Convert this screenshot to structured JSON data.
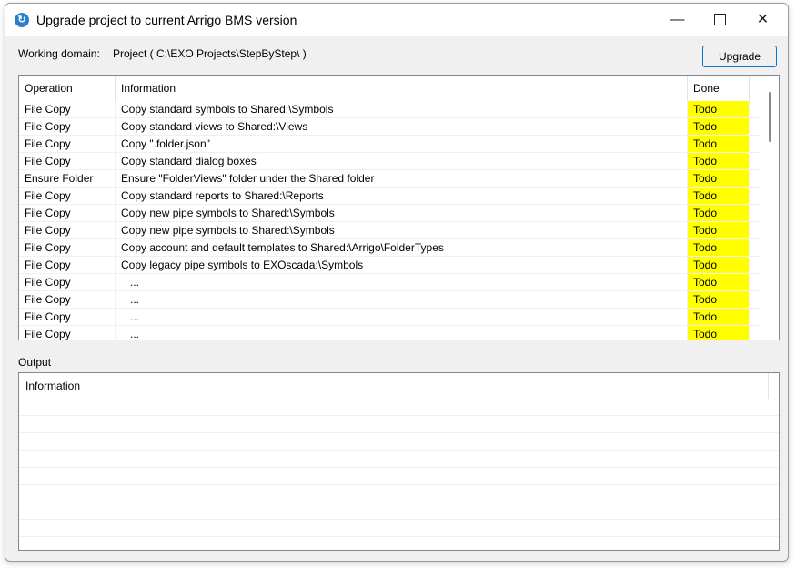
{
  "window": {
    "title": "Upgrade project to current Arrigo BMS version",
    "controls": {
      "minimize": "—",
      "maximize": "",
      "close": "✕"
    }
  },
  "header": {
    "working_domain_label": "Working domain:",
    "working_domain_value": "Project ( C:\\EXO Projects\\StepByStep\\ )",
    "upgrade_button": "Upgrade"
  },
  "operations": {
    "columns": [
      "Operation",
      "Information",
      "Done"
    ],
    "rows": [
      {
        "operation": "File Copy",
        "information": "Copy standard symbols to Shared:\\Symbols",
        "done": "Todo"
      },
      {
        "operation": "File Copy",
        "information": "Copy standard views to Shared:\\Views",
        "done": "Todo"
      },
      {
        "operation": "File Copy",
        "information": "Copy \".folder.json\"",
        "done": "Todo"
      },
      {
        "operation": "File Copy",
        "information": "Copy standard dialog boxes",
        "done": "Todo"
      },
      {
        "operation": "Ensure Folder",
        "information": "Ensure \"FolderViews\" folder under the Shared folder",
        "done": "Todo"
      },
      {
        "operation": "File Copy",
        "information": "Copy standard reports to Shared:\\Reports",
        "done": "Todo"
      },
      {
        "operation": "File Copy",
        "information": "Copy new pipe symbols to Shared:\\Symbols",
        "done": "Todo"
      },
      {
        "operation": "File Copy",
        "information": "Copy new pipe symbols to Shared:\\Symbols",
        "done": "Todo"
      },
      {
        "operation": "File Copy",
        "information": "Copy account and default templates to Shared:\\Arrigo\\FolderTypes",
        "done": "Todo"
      },
      {
        "operation": "File Copy",
        "information": "Copy legacy pipe symbols to EXOscada:\\Symbols",
        "done": "Todo"
      },
      {
        "operation": "File Copy",
        "information": "   ...",
        "done": "Todo"
      },
      {
        "operation": "File Copy",
        "information": "   ...",
        "done": "Todo"
      },
      {
        "operation": "File Copy",
        "information": "   ...",
        "done": "Todo"
      },
      {
        "operation": "File Copy",
        "information": "   ...",
        "done": "Todo"
      }
    ]
  },
  "output": {
    "label": "Output",
    "column": "Information"
  },
  "colors": {
    "todo_highlight": "#ffff00",
    "accent": "#0078d7",
    "app_icon": "#2a80c9"
  }
}
